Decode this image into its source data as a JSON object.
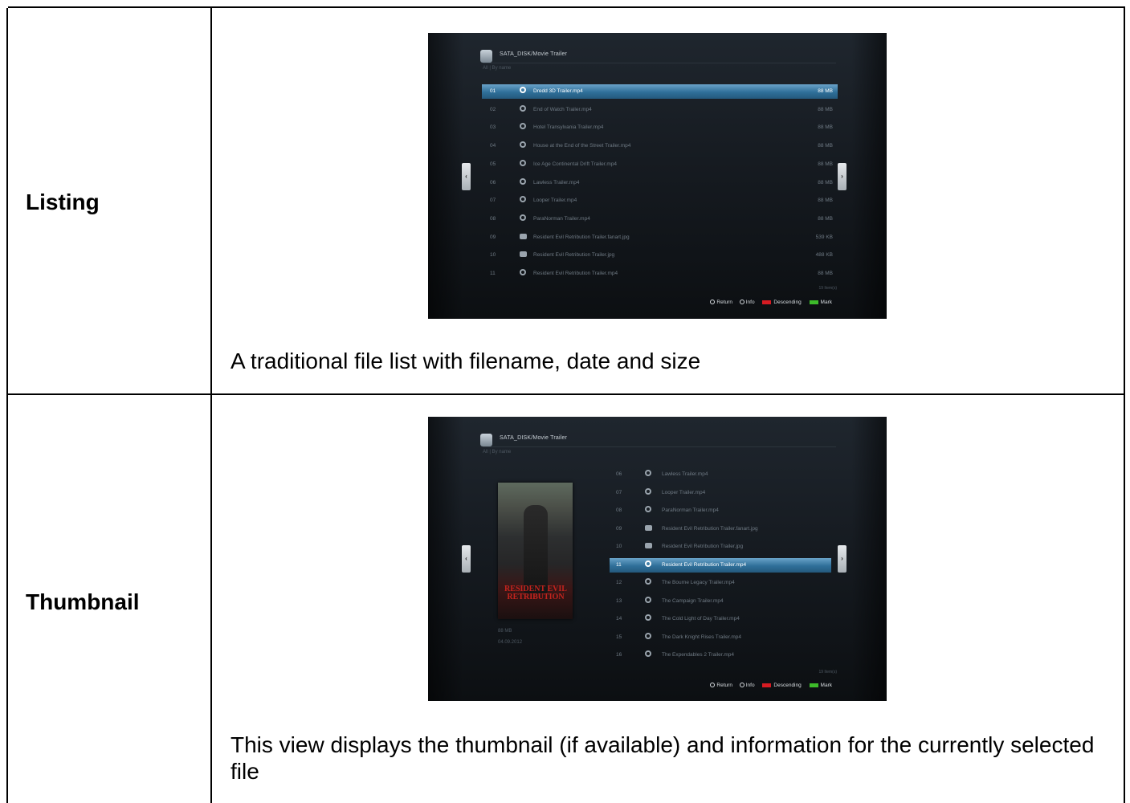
{
  "rows": [
    {
      "label": "Listing",
      "caption": "A traditional file list with filename, date and size",
      "screen": {
        "path": "SATA_DISK/Movie Trailer",
        "sort": "All | By name",
        "items": [
          {
            "num": "01",
            "icon": "magnifier-icon",
            "name": "Dredd 3D Trailer.mp4",
            "size": "88 MB",
            "selected": true
          },
          {
            "num": "02",
            "icon": "magnifier-icon",
            "name": "End of Watch Trailer.mp4",
            "size": "88 MB"
          },
          {
            "num": "03",
            "icon": "magnifier-icon",
            "name": "Hotel Transylvania Trailer.mp4",
            "size": "88 MB"
          },
          {
            "num": "04",
            "icon": "magnifier-icon",
            "name": "House at the End of the Street Trailer.mp4",
            "size": "88 MB"
          },
          {
            "num": "05",
            "icon": "magnifier-icon",
            "name": "Ice Age Continental Drift Trailer.mp4",
            "size": "88 MB"
          },
          {
            "num": "06",
            "icon": "magnifier-icon",
            "name": "Lawless Trailer.mp4",
            "size": "88 MB"
          },
          {
            "num": "07",
            "icon": "magnifier-icon",
            "name": "Looper Trailer.mp4",
            "size": "88 MB"
          },
          {
            "num": "08",
            "icon": "magnifier-icon",
            "name": "ParaNorman Trailer.mp4",
            "size": "88 MB"
          },
          {
            "num": "09",
            "icon": "camera-icon",
            "name": "Resident Evil Retribution Trailer.fanart.jpg",
            "size": "539 KB"
          },
          {
            "num": "10",
            "icon": "camera-icon",
            "name": "Resident Evil Retribution Trailer.jpg",
            "size": "488 KB"
          },
          {
            "num": "11",
            "icon": "magnifier-icon",
            "name": "Resident Evil Retribution Trailer.mp4",
            "size": "88 MB"
          }
        ],
        "count": "19 Item(s)",
        "legend": {
          "return": "Return",
          "info": "Info",
          "red": "Descending",
          "green": "Mark"
        }
      }
    },
    {
      "label": "Thumbnail",
      "caption": "This view displays the thumbnail (if available) and information for the currently selected file",
      "screen": {
        "path": "SATA_DISK/Movie Trailer",
        "sort": "All | By name",
        "poster_title": "RESIDENT EVIL RETRIBUTION",
        "meta_size": "88 MB",
        "meta_date": "04.09.2012",
        "items": [
          {
            "num": "06",
            "icon": "magnifier-icon",
            "name": "Lawless Trailer.mp4"
          },
          {
            "num": "07",
            "icon": "magnifier-icon",
            "name": "Looper Trailer.mp4"
          },
          {
            "num": "08",
            "icon": "magnifier-icon",
            "name": "ParaNorman Trailer.mp4"
          },
          {
            "num": "09",
            "icon": "camera-icon",
            "name": "Resident Evil Retribution Trailer.fanart.jpg"
          },
          {
            "num": "10",
            "icon": "camera-icon",
            "name": "Resident Evil Retribution Trailer.jpg"
          },
          {
            "num": "11",
            "icon": "magnifier-icon",
            "name": "Resident Evil Retribution Trailer.mp4",
            "selected": true
          },
          {
            "num": "12",
            "icon": "magnifier-icon",
            "name": "The Bourne Legacy Trailer.mp4"
          },
          {
            "num": "13",
            "icon": "magnifier-icon",
            "name": "The Campaign Trailer.mp4"
          },
          {
            "num": "14",
            "icon": "magnifier-icon",
            "name": "The Cold Light of Day Trailer.mp4"
          },
          {
            "num": "15",
            "icon": "magnifier-icon",
            "name": "The Dark Knight Rises Trailer.mp4"
          },
          {
            "num": "16",
            "icon": "magnifier-icon",
            "name": "The Expendables 2 Trailer.mp4"
          }
        ],
        "count": "19 Item(s)",
        "legend": {
          "return": "Return",
          "info": "Info",
          "red": "Descending",
          "green": "Mark"
        }
      }
    }
  ]
}
